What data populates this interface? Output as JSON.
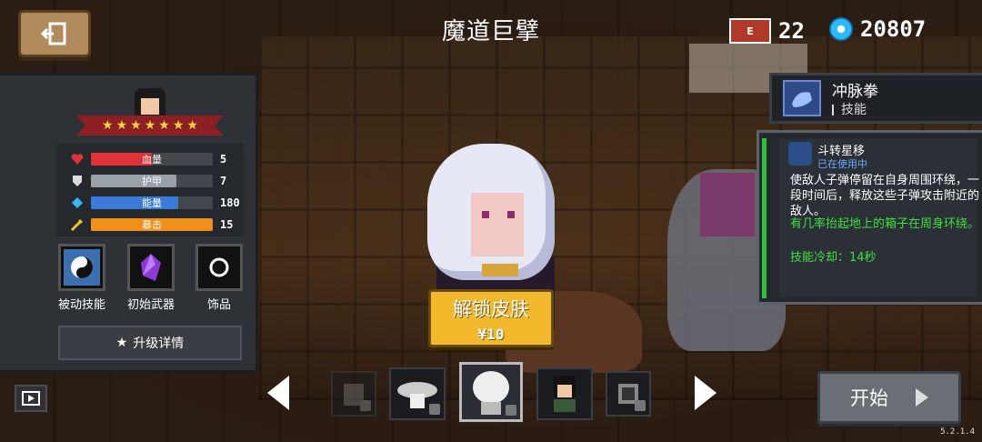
{
  "header": {
    "title": "魔道巨擘",
    "energy_label": "E",
    "energy_count": "22",
    "gem_count": "20807"
  },
  "character": {
    "stars": [
      "★",
      "★",
      "★",
      "★",
      "★",
      "★",
      "★"
    ],
    "stats": [
      {
        "label": "血量",
        "value": "5",
        "fill": 0.5,
        "color": "#e0343a"
      },
      {
        "label": "护甲",
        "value": "7",
        "fill": 0.7,
        "color": "#9aa0a8"
      },
      {
        "label": "能量",
        "value": "180",
        "fill": 0.72,
        "color": "#3b7bd8"
      },
      {
        "label": "暴击",
        "value": "15",
        "fill": 1.0,
        "color": "#f0901a"
      }
    ],
    "slots": [
      {
        "label": "被动技能",
        "icon": "yin-yang-icon"
      },
      {
        "label": "初始武器",
        "icon": "purple-crystal-icon"
      },
      {
        "label": "饰品",
        "icon": "ring-icon"
      }
    ],
    "upgrade_label": "升级详情"
  },
  "unlock": {
    "title": "解锁皮肤",
    "price": "¥10"
  },
  "skill": {
    "name": "冲脉拳",
    "type": "技能"
  },
  "tooltip": {
    "title": "斗转星移",
    "status": "已在使用中",
    "description": "使敌人子弹停留在自身周围环绕，一段时间后，释放这些子弹攻击附近的敌人。",
    "note": "有几率抬起地上的箱子在周身环绕。",
    "cooldown": "技能冷却：14秒"
  },
  "start_label": "开始",
  "version": "5.2.1.4",
  "colors": {
    "unlock": "#f2b92c",
    "tooltip_green": "#3fe03f",
    "tooltip_blue": "#6aa8ff"
  }
}
